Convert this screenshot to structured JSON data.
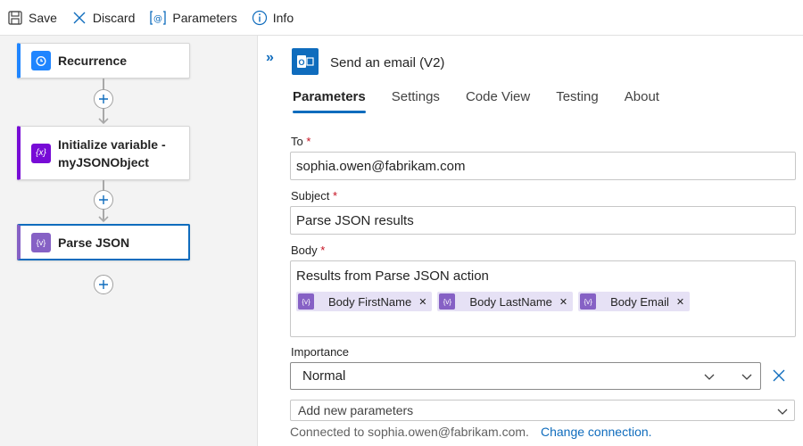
{
  "toolbar": {
    "save_label": "Save",
    "discard_label": "Discard",
    "parameters_label": "Parameters",
    "info_label": "Info"
  },
  "designer": {
    "cards": [
      {
        "title": "Recurrence",
        "icon": "alarm-clock-icon",
        "accent": "#1f85ff"
      },
      {
        "title_line1": "Initialize variable -",
        "title_line2": "myJSONObject",
        "icon": "variable-icon",
        "accent": "#770bd6"
      },
      {
        "title": "Parse JSON",
        "icon": "parse-json-icon",
        "accent": "#8661c5"
      }
    ]
  },
  "panel": {
    "title": "Send an email (V2)",
    "icon": "outlook-icon",
    "tabs": [
      "Parameters",
      "Settings",
      "Code View",
      "Testing",
      "About"
    ],
    "active_tab": "Parameters",
    "to_label": "To",
    "to_value": "sophia.owen@fabrikam.com",
    "subject_label": "Subject",
    "subject_value": "Parse JSON results",
    "body_label": "Body",
    "body_text": "Results from Parse JSON action",
    "body_tokens": [
      "Body FirstName",
      "Body LastName",
      "Body Email"
    ],
    "required_marker": "*",
    "importance_label": "Importance",
    "importance_value": "Normal",
    "add_params_placeholder": "Add new parameters",
    "connection_text": "Connected to sophia.owen@fabrikam.com.",
    "change_connection": "Change connection."
  },
  "colors": {
    "accent": "#0f6cbd",
    "token_bg": "#e6e1f5",
    "token_icon": "#8661c5",
    "required": "#c50f1f"
  }
}
